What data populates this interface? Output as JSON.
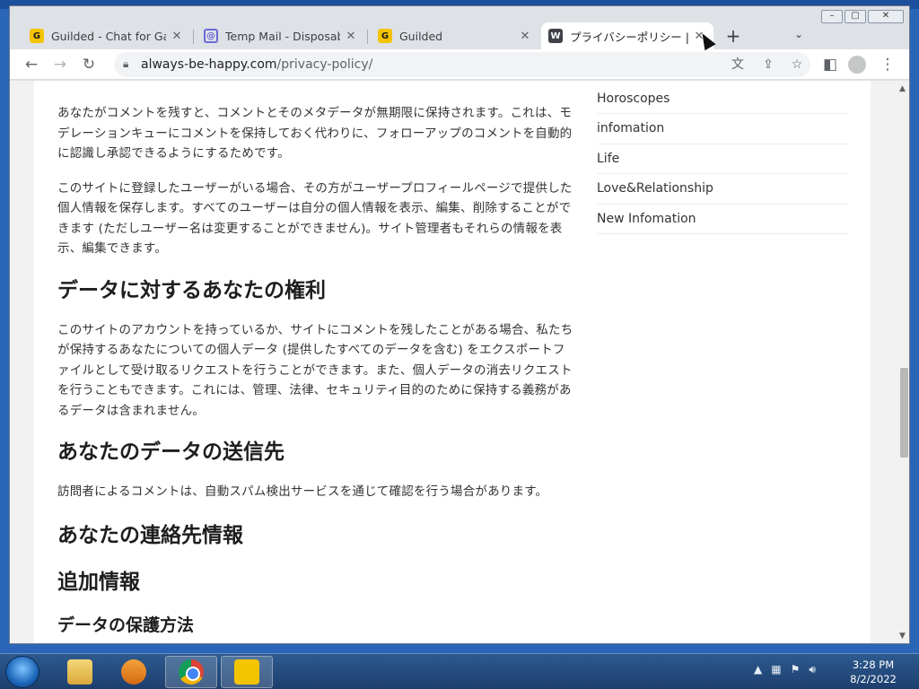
{
  "browser": {
    "tabs": [
      {
        "title": "Guilded - Chat for Gamin",
        "favicon": "guilded-icon"
      },
      {
        "title": "Temp Mail - Disposable",
        "favicon": "at-sign-icon"
      },
      {
        "title": "Guilded",
        "favicon": "guilded-icon"
      },
      {
        "title": "プライバシーポリシー | Alwa",
        "favicon": "wordpress-icon",
        "active": true
      }
    ],
    "url_host": "always-be-happy.com",
    "url_path": "/privacy-policy/"
  },
  "article": {
    "p1": "あなたがコメントを残すと、コメントとそのメタデータが無期限に保持されます。これは、モデレーションキューにコメントを保持しておく代わりに、フォローアップのコメントを自動的に認識し承認できるようにするためです。",
    "p2": "このサイトに登録したユーザーがいる場合、その方がユーザープロフィールページで提供した個人情報を保存します。すべてのユーザーは自分の個人情報を表示、編集、削除することができます (ただしユーザー名は変更することができません)。サイト管理者もそれらの情報を表示、編集できます。",
    "h_rights": "データに対するあなたの権利",
    "p3": "このサイトのアカウントを持っているか、サイトにコメントを残したことがある場合、私たちが保持するあなたについての個人データ (提供したすべてのデータを含む) をエクスポートファイルとして受け取るリクエストを行うことができます。また、個人データの消去リクエストを行うこともできます。これには、管理、法律、セキュリティ目的のために保持する義務があるデータは含まれません。",
    "h_send": "あなたのデータの送信先",
    "p4": "訪問者によるコメントは、自動スパム検出サービスを通じて確認を行う場合があります。",
    "h_contact": "あなたの連絡先情報",
    "h_extra": "追加情報",
    "h_protect": "データの保護方法"
  },
  "sidebar": {
    "items": [
      "Horoscopes",
      "infomation",
      "Life",
      "Love&Relationship",
      "New Infomation"
    ]
  },
  "taskbar": {
    "time": "3:28 PM",
    "date": "8/2/2022"
  }
}
